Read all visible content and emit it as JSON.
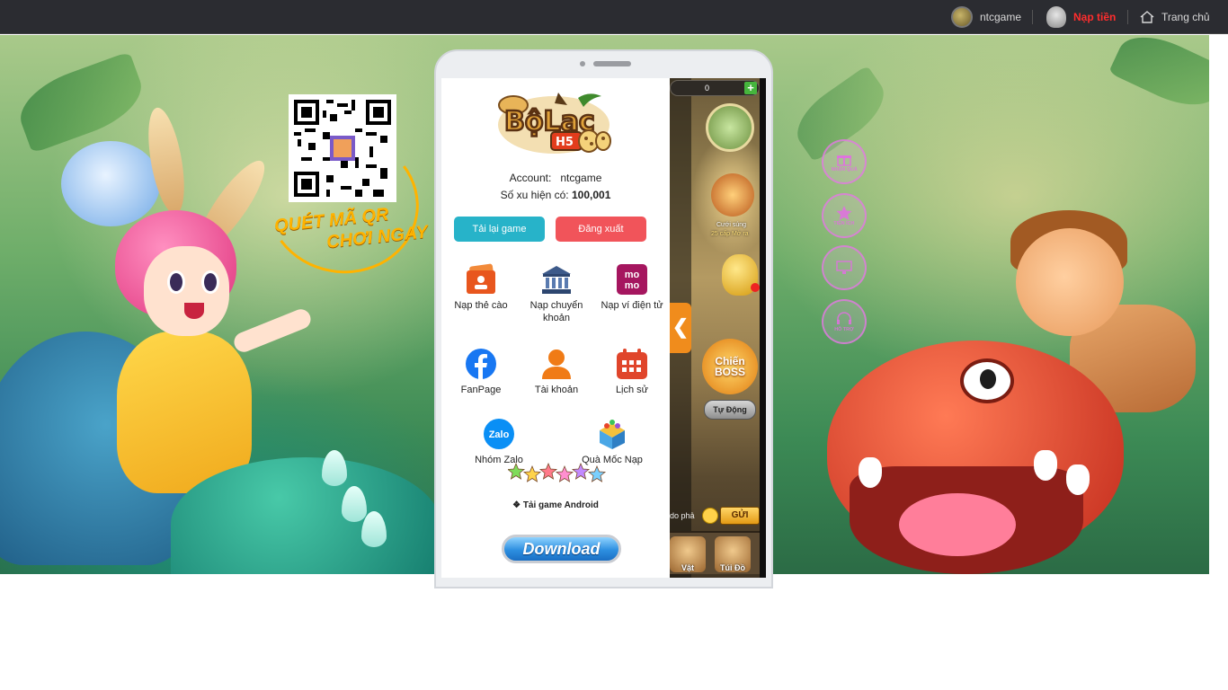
{
  "topbar": {
    "username": "ntcgame",
    "topup_label": "Nạp tiền",
    "home_label": "Trang chủ"
  },
  "qr_promo": {
    "line1": "QUÉT MÃ QR",
    "line2": "CHƠI NGAY"
  },
  "side_buttons": [
    "NHẬN QUÀ",
    "TIỆN ÍCH",
    "",
    "HỖ TRỢ"
  ],
  "panel": {
    "account_label": "Account:",
    "account_value": "ntcgame",
    "coin_label": "Số xu hiện có:",
    "coin_value": "100,001",
    "reload_button": "Tải lại game",
    "logout_button": "Đăng xuất",
    "menu": [
      {
        "label": "Nạp thẻ cào",
        "icon": "card-topup-icon"
      },
      {
        "label": "Nạp chuyển khoản",
        "icon": "bank-icon"
      },
      {
        "label": "Nạp ví điện tử",
        "icon": "momo-icon"
      },
      {
        "label": "FanPage",
        "icon": "facebook-icon"
      },
      {
        "label": "Tài khoản",
        "icon": "user-icon"
      },
      {
        "label": "Lịch sử",
        "icon": "calendar-icon"
      },
      {
        "label": "Nhóm Zalo",
        "icon": "zalo-icon"
      },
      {
        "label": "Quà Mốc Nạp",
        "icon": "gift-box-icon"
      }
    ],
    "zalo_text": "Zalo",
    "momo_text": "mo mo",
    "android_label": "❖ Tải game Android",
    "download_button": "Download"
  },
  "game": {
    "coin_counter": "0",
    "event_label": "Cưới súng",
    "event_sublabel": "25 cấp Mở ra",
    "boss_label": "Chiến BOSS",
    "auto_button": "Tự Động",
    "chat_placeholder": "do phả",
    "send_button": "GỬI",
    "bottom_items": [
      "Vật",
      "Túi Đồ"
    ],
    "collapse_arrow": "❮"
  },
  "colors": {
    "topbar_bg": "#2b2c31",
    "topup_red": "#ff2d2d",
    "reload_teal": "#27b3c9",
    "logout_red": "#f1545a",
    "qr_orange": "#ffb300"
  }
}
